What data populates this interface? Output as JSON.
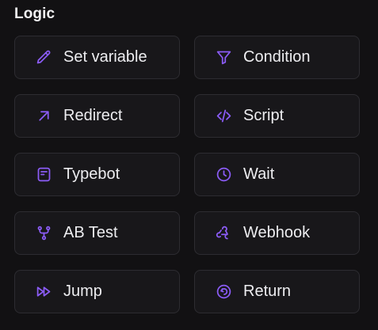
{
  "section": {
    "title": "Logic"
  },
  "accent_color": "#8b5cf6",
  "blocks": [
    {
      "label": "Set variable",
      "icon": "pencil-icon"
    },
    {
      "label": "Condition",
      "icon": "filter-icon"
    },
    {
      "label": "Redirect",
      "icon": "arrow-up-right-icon"
    },
    {
      "label": "Script",
      "icon": "code-icon"
    },
    {
      "label": "Typebot",
      "icon": "typebot-icon"
    },
    {
      "label": "Wait",
      "icon": "clock-icon"
    },
    {
      "label": "AB Test",
      "icon": "git-branch-icon"
    },
    {
      "label": "Webhook",
      "icon": "webhook-icon"
    },
    {
      "label": "Jump",
      "icon": "fast-forward-icon"
    },
    {
      "label": "Return",
      "icon": "return-icon"
    }
  ]
}
